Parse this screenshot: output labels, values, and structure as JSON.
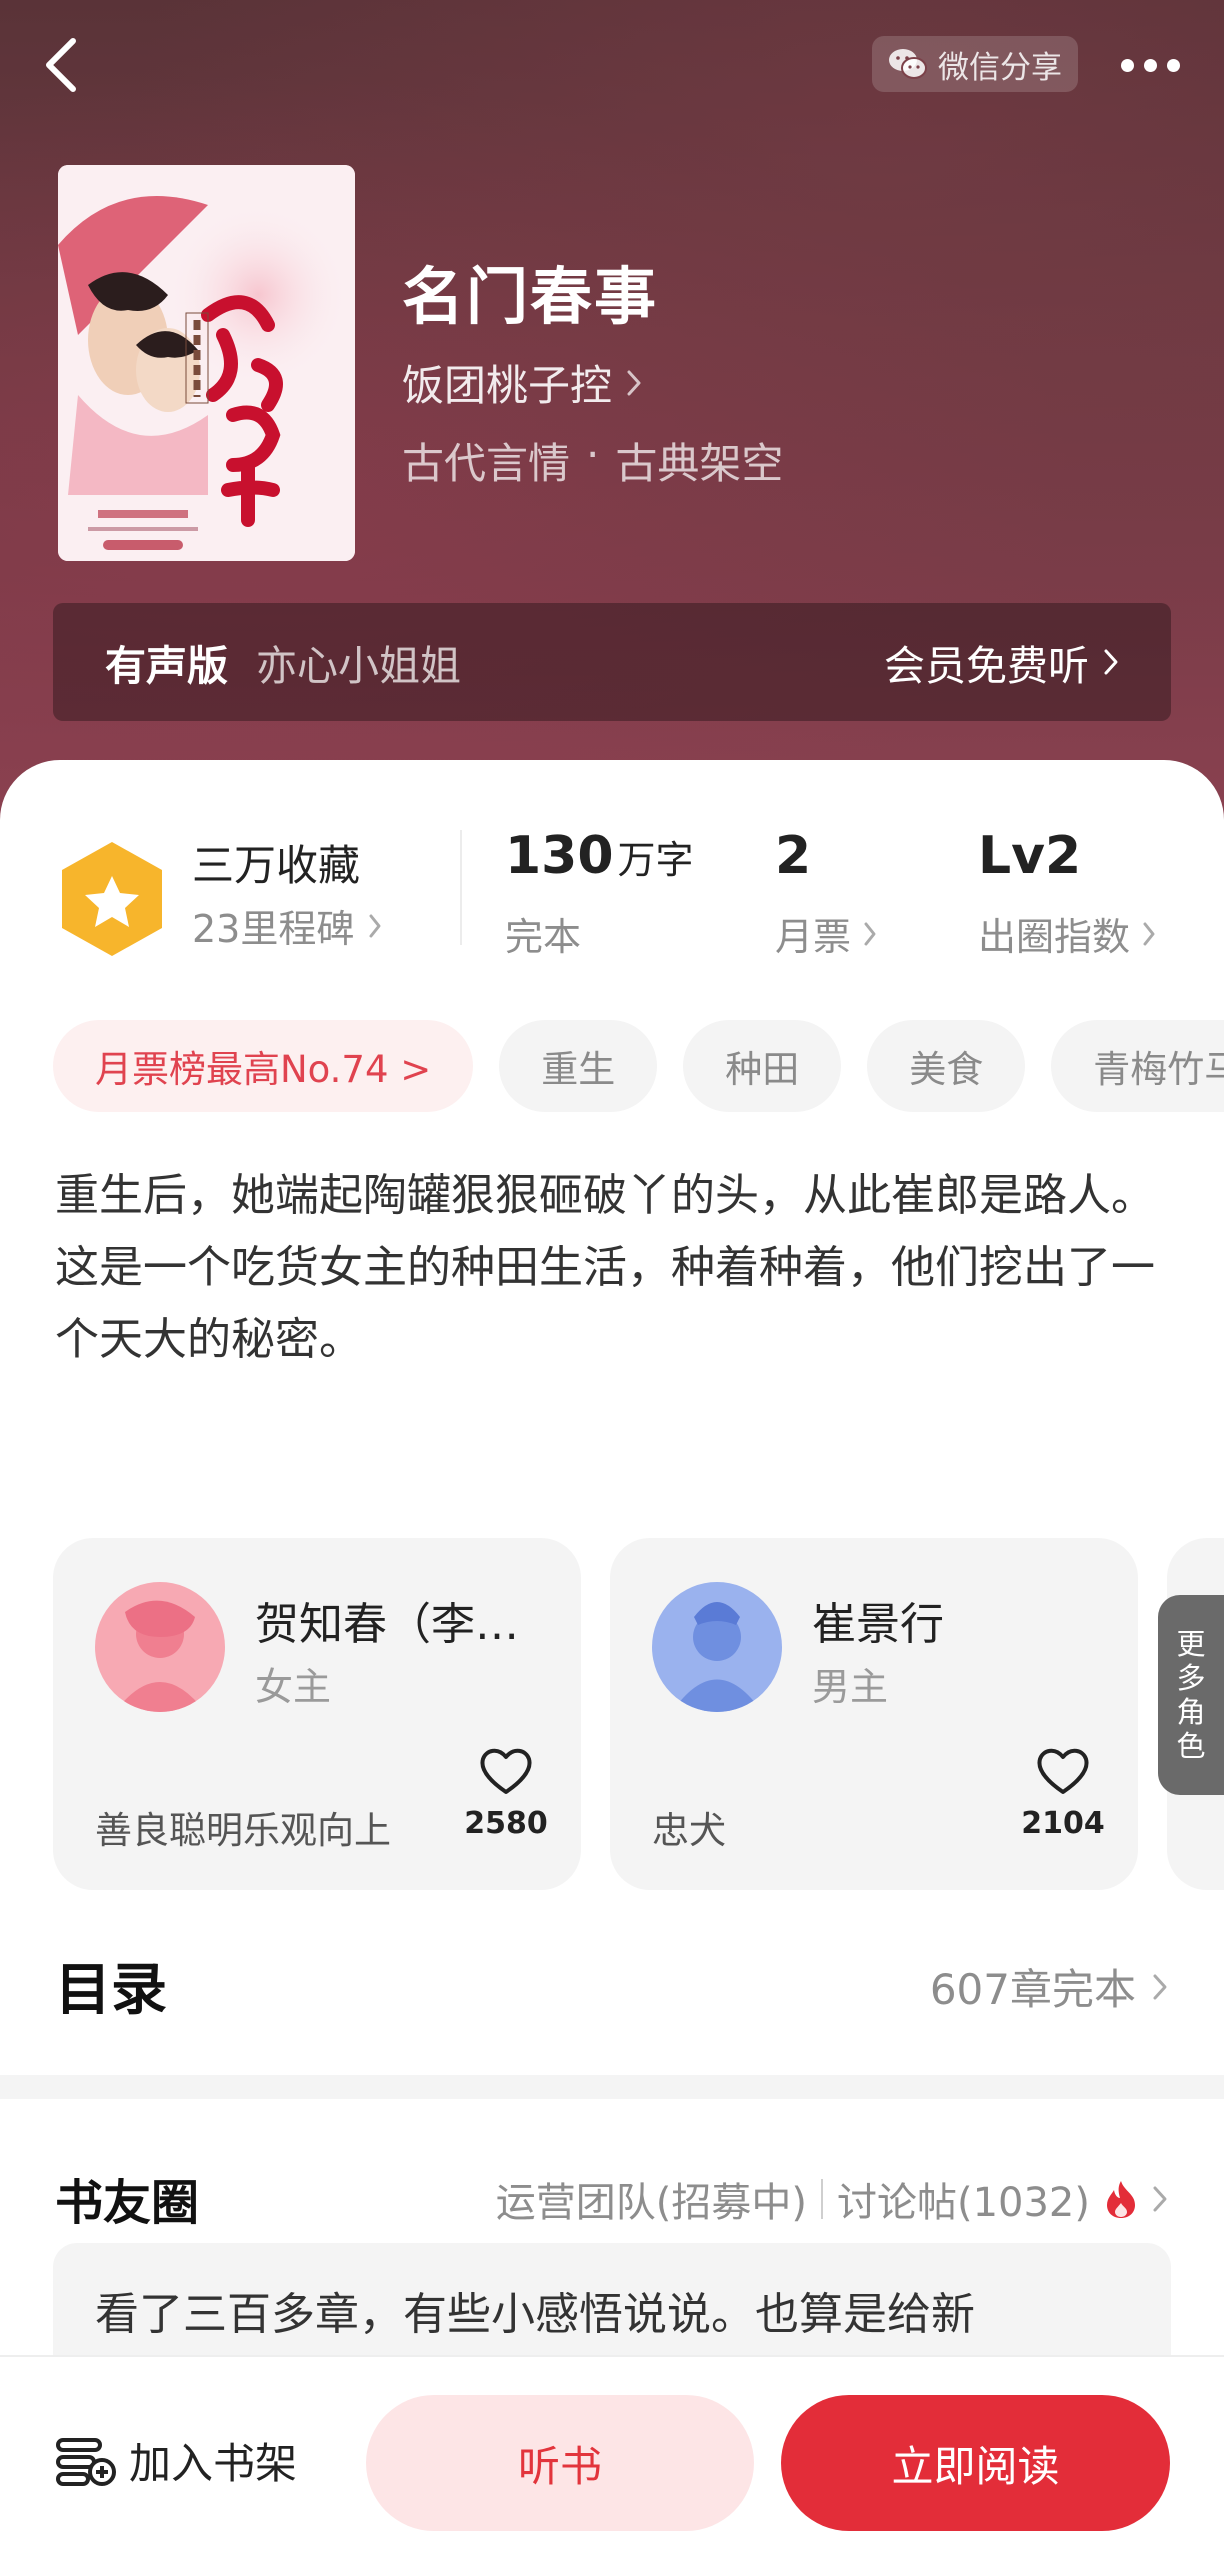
{
  "header": {
    "share_label": "微信分享",
    "share_icon": "wechat-icon",
    "back_icon": "back-chevron-icon",
    "more_icon": "more-dots-icon"
  },
  "book": {
    "title": "名门春事",
    "author": "饭团桃子控",
    "genres": [
      "古代言情",
      "·",
      "古典架空"
    ],
    "cover_title": "名门春事",
    "cover_author": "饭团桃子控"
  },
  "audio": {
    "label": "有声版",
    "narrator": "亦心小姐姐",
    "free_label": "会员免费听"
  },
  "stats": {
    "favorites": "三万收藏",
    "milestones": "23里程碑",
    "word_count": "130",
    "word_unit": "万字",
    "status": "完本",
    "monthly_tickets": "2",
    "monthly_tickets_label": "月票",
    "level": "Lv2",
    "level_label": "出圈指数"
  },
  "tags": [
    "月票榜最高No.74 >",
    "重生",
    "种田",
    "美食",
    "青梅竹马"
  ],
  "synopsis": {
    "line1": "重生后，她端起陶罐狠狠砸破丫的头，从此崔郎是路人。",
    "line2": "这是一个吃货女主的种田生活，种着种着，他们挖出了一个天大的秘密。"
  },
  "characters": [
    {
      "name": "贺知春（李…",
      "role": "女主",
      "desc": "善良聪明乐观向上",
      "likes": "2580"
    },
    {
      "name": "崔景行",
      "role": "男主",
      "desc": "忠犬",
      "likes": "2104"
    }
  ],
  "more_roles": [
    "更",
    "多",
    "角",
    "色"
  ],
  "toc": {
    "title": "目录",
    "info": "607章完本"
  },
  "circle": {
    "title": "书友圈",
    "team": "运营团队(招募中)",
    "discussion": "讨论帖(1032)",
    "post_preview": "看了三百多章，有些小感悟说说。也算是给新"
  },
  "bottom": {
    "shelf": "加入书架",
    "listen": "听书",
    "read": "立即阅读"
  },
  "colors": {
    "accent": "#e32d39",
    "accent_light": "#fde5e6",
    "header_bg": "#6e3a42",
    "badge": "#f7b52c"
  }
}
